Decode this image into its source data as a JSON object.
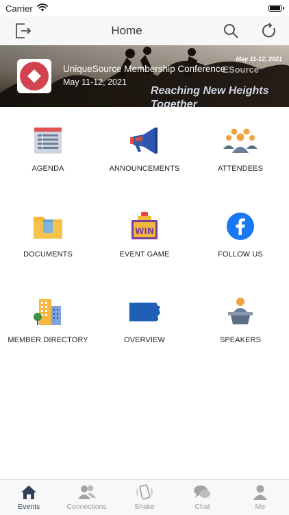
{
  "status_bar": {
    "carrier": "Carrier"
  },
  "nav": {
    "title": "Home"
  },
  "banner": {
    "event_title": "UniqueSource Membership Conference",
    "event_date": "May 11-12, 2021",
    "photo_date": "May 11-12, 2021",
    "photo_brand": "ESource",
    "photo_tagline_1": "Reaching New Heights",
    "photo_tagline_2": "Together"
  },
  "tiles": [
    {
      "label": "AGENDA",
      "icon": "agenda-icon"
    },
    {
      "label": "ANNOUNCEMENTS",
      "icon": "megaphone-icon"
    },
    {
      "label": "ATTENDEES",
      "icon": "people-icon"
    },
    {
      "label": "DOCUMENTS",
      "icon": "folder-icon"
    },
    {
      "label": "EVENT GAME",
      "icon": "win-sign-icon"
    },
    {
      "label": "FOLLOW US",
      "icon": "facebook-icon"
    },
    {
      "label": "MEMBER DIRECTORY",
      "icon": "buildings-icon"
    },
    {
      "label": "OVERVIEW",
      "icon": "state-map-icon"
    },
    {
      "label": "SPEAKERS",
      "icon": "podium-icon"
    }
  ],
  "tabbar": {
    "items": [
      {
        "label": "Events",
        "icon": "home-icon"
      },
      {
        "label": "Connections",
        "icon": "users-icon"
      },
      {
        "label": "Shake",
        "icon": "phone-shake-icon"
      },
      {
        "label": "Chat",
        "icon": "chat-icon"
      },
      {
        "label": "Me",
        "icon": "person-icon"
      }
    ]
  },
  "colors": {
    "accent_active": "#2f3f5c",
    "tab_inactive": "#9a9a9a",
    "logo_red": "#d2434f"
  }
}
